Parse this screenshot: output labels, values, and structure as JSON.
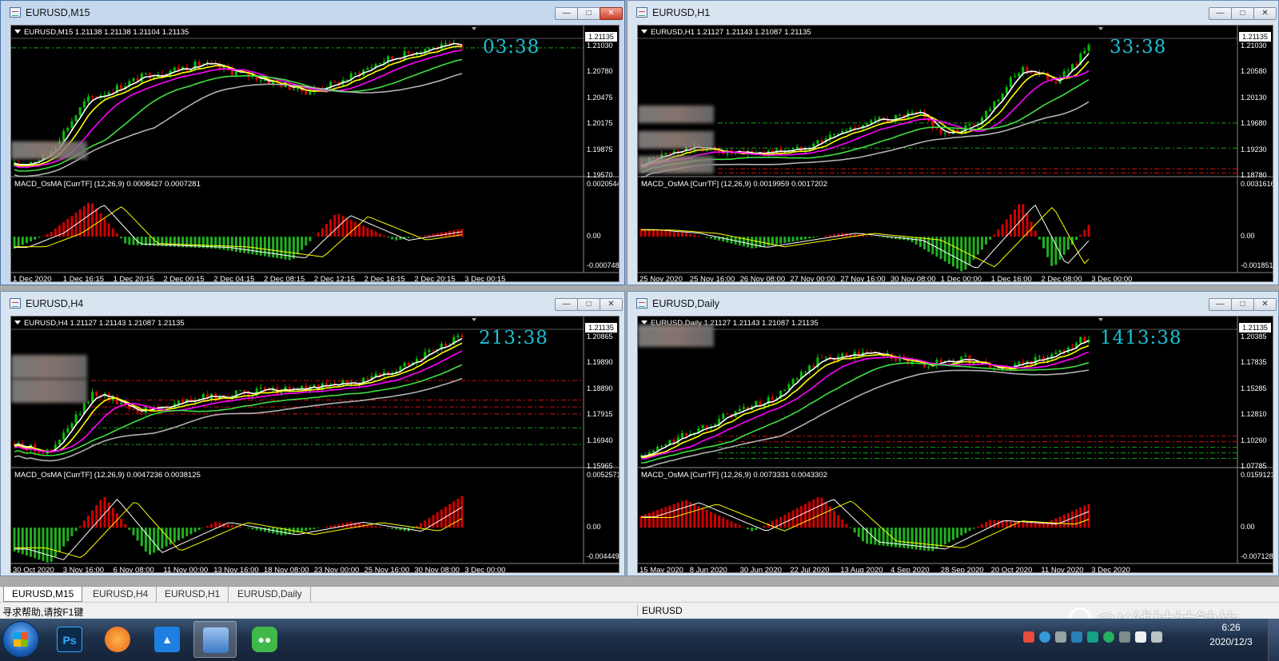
{
  "windows": [
    {
      "id": "m15",
      "title": "EURUSD,M15",
      "info": "EURUSD,M15  1.21138 1.21138 1.21104 1.21135",
      "timer": "03:38",
      "price_current": "1.21135",
      "price_labels": [
        "1.21030",
        "1.20780",
        "1.20475",
        "1.20175",
        "1.19875",
        "1.19570"
      ],
      "macd_label": "MACD_OsMA [CurrTF] (12,26,9) 0.0008427 0.0007281",
      "macd_labels": [
        "0.0020544",
        "0.00",
        "-0.000748"
      ],
      "x_labels": [
        "1 Dec 2020",
        "1 Dec 16:15",
        "1 Dec 20:15",
        "2 Dec 00:15",
        "2 Dec 04:15",
        "2 Dec 08:15",
        "2 Dec 12:15",
        "2 Dec 16:15",
        "2 Dec 20:15",
        "3 Dec 00:15"
      ]
    },
    {
      "id": "h1",
      "title": "EURUSD,H1",
      "info": "EURUSD,H1  1.21127 1.21143 1.21087 1.21135",
      "timer": "33:38",
      "price_current": "1.21135",
      "price_labels": [
        "1.21030",
        "1.20580",
        "1.20130",
        "1.19680",
        "1.19230",
        "1.18780"
      ],
      "macd_label": "MACD_OsMA [CurrTF] (12,26,9) 0.0019959 0.0017202",
      "macd_labels": [
        "0.0031616",
        "0.00",
        "-0.001851"
      ],
      "x_labels": [
        "25 Nov 2020",
        "25 Nov 16:00",
        "26 Nov 08:00",
        "27 Nov 00:00",
        "27 Nov 16:00",
        "30 Nov 08:00",
        "1 Dec 00:00",
        "1 Dec 16:00",
        "2 Dec 08:00",
        "3 Dec 00:00"
      ]
    },
    {
      "id": "h4",
      "title": "EURUSD,H4",
      "info": "EURUSD,H4  1.21127 1.21143 1.21087 1.21135",
      "timer": "213:38",
      "price_current": "1.21135",
      "price_labels": [
        "1.20865",
        "1.19890",
        "1.18890",
        "1.17915",
        "1.16940",
        "1.15965"
      ],
      "macd_label": "MACD_OsMA [CurrTF] (12,26,9) 0.0047236 0.0038125",
      "macd_labels": [
        "0.0052571",
        "0.00",
        "-0.004449"
      ],
      "x_labels": [
        "30 Oct 2020",
        "3 Nov 16:00",
        "6 Nov 08:00",
        "11 Nov 00:00",
        "13 Nov 16:00",
        "18 Nov 08:00",
        "23 Nov 00:00",
        "25 Nov 16:00",
        "30 Nov 08:00",
        "3 Dec 00:00"
      ]
    },
    {
      "id": "daily",
      "title": "EURUSD,Daily",
      "info": "EURUSD,Daily  1.21127 1.21143 1.21087 1.21135",
      "timer": "1413:38",
      "price_current": "1.21135",
      "price_labels": [
        "1.20385",
        "1.17835",
        "1.15285",
        "1.12810",
        "1.10260",
        "1.07785"
      ],
      "macd_label": "MACD_OsMA [CurrTF] (12,26,9) 0.0073331 0.0043302",
      "macd_labels": [
        "0.0159121",
        "0.00",
        "-0.007128"
      ],
      "x_labels": [
        "15 May 2020",
        "8 Jun 2020",
        "30 Jun 2020",
        "22 Jul 2020",
        "13 Aug 2020",
        "4 Sep 2020",
        "28 Sep 2020",
        "20 Oct 2020",
        "11 Nov 2020",
        "3 Dec 2020"
      ]
    }
  ],
  "tabs": [
    "EURUSD,M15",
    "EURUSD,H4",
    "EURUSD,H1",
    "EURUSD,Daily"
  ],
  "status": {
    "help": "寻求帮助,请按F1键",
    "symbol": "EURUSD"
  },
  "watermark": "@K线姑姑钟竹",
  "clock": {
    "time": "6:26",
    "date": "2020/12/3"
  },
  "colors": {
    "bull": "#00c000",
    "bear": "#e00000",
    "ma_white": "#ffffff",
    "ma_yellow": "#ffff00",
    "ma_magenta": "#ff00ff",
    "ma_green": "#40e040",
    "ma_grey": "#b0b0b0",
    "timer": "#1ec0d2"
  },
  "taskbar_icons": [
    "start-orb",
    "photoshop-icon",
    "fox-icon",
    "cloud-app-icon",
    "metatrader-icon",
    "wechat-icon"
  ]
}
